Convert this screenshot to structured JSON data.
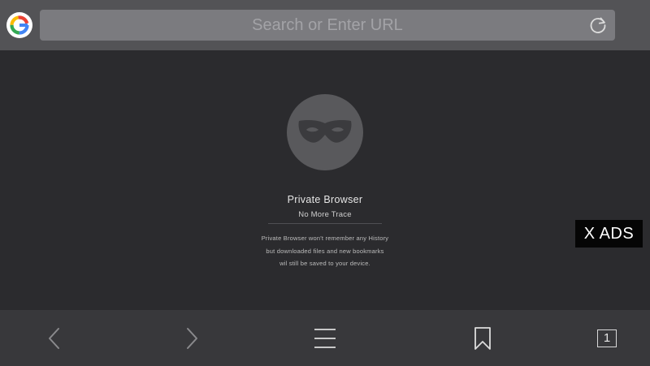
{
  "top_bar": {
    "logo_icon": "google-g-icon",
    "search": {
      "placeholder": "Search or Enter URL",
      "value": ""
    },
    "reload_icon": "reload-icon"
  },
  "private_panel": {
    "icon": "incognito-mask-icon",
    "title": "Private Browser",
    "subtitle": "No More Trace",
    "description_lines": [
      "Private Browser won't remember any History",
      "but downloaded files and new bookmarks",
      "wil still be saved to your device."
    ]
  },
  "ads_button": {
    "label": "X ADS"
  },
  "toolbar": {
    "back_icon": "chevron-left-icon",
    "forward_icon": "chevron-right-icon",
    "menu_icon": "hamburger-menu-icon",
    "bookmark_icon": "bookmark-icon",
    "tab_count": "1"
  },
  "colors": {
    "top_bar": "#535356",
    "url_field": "#7b7b7f",
    "content_background": "#2b2b2e",
    "toolbar": "#38383b",
    "ads_background": "#050505"
  }
}
